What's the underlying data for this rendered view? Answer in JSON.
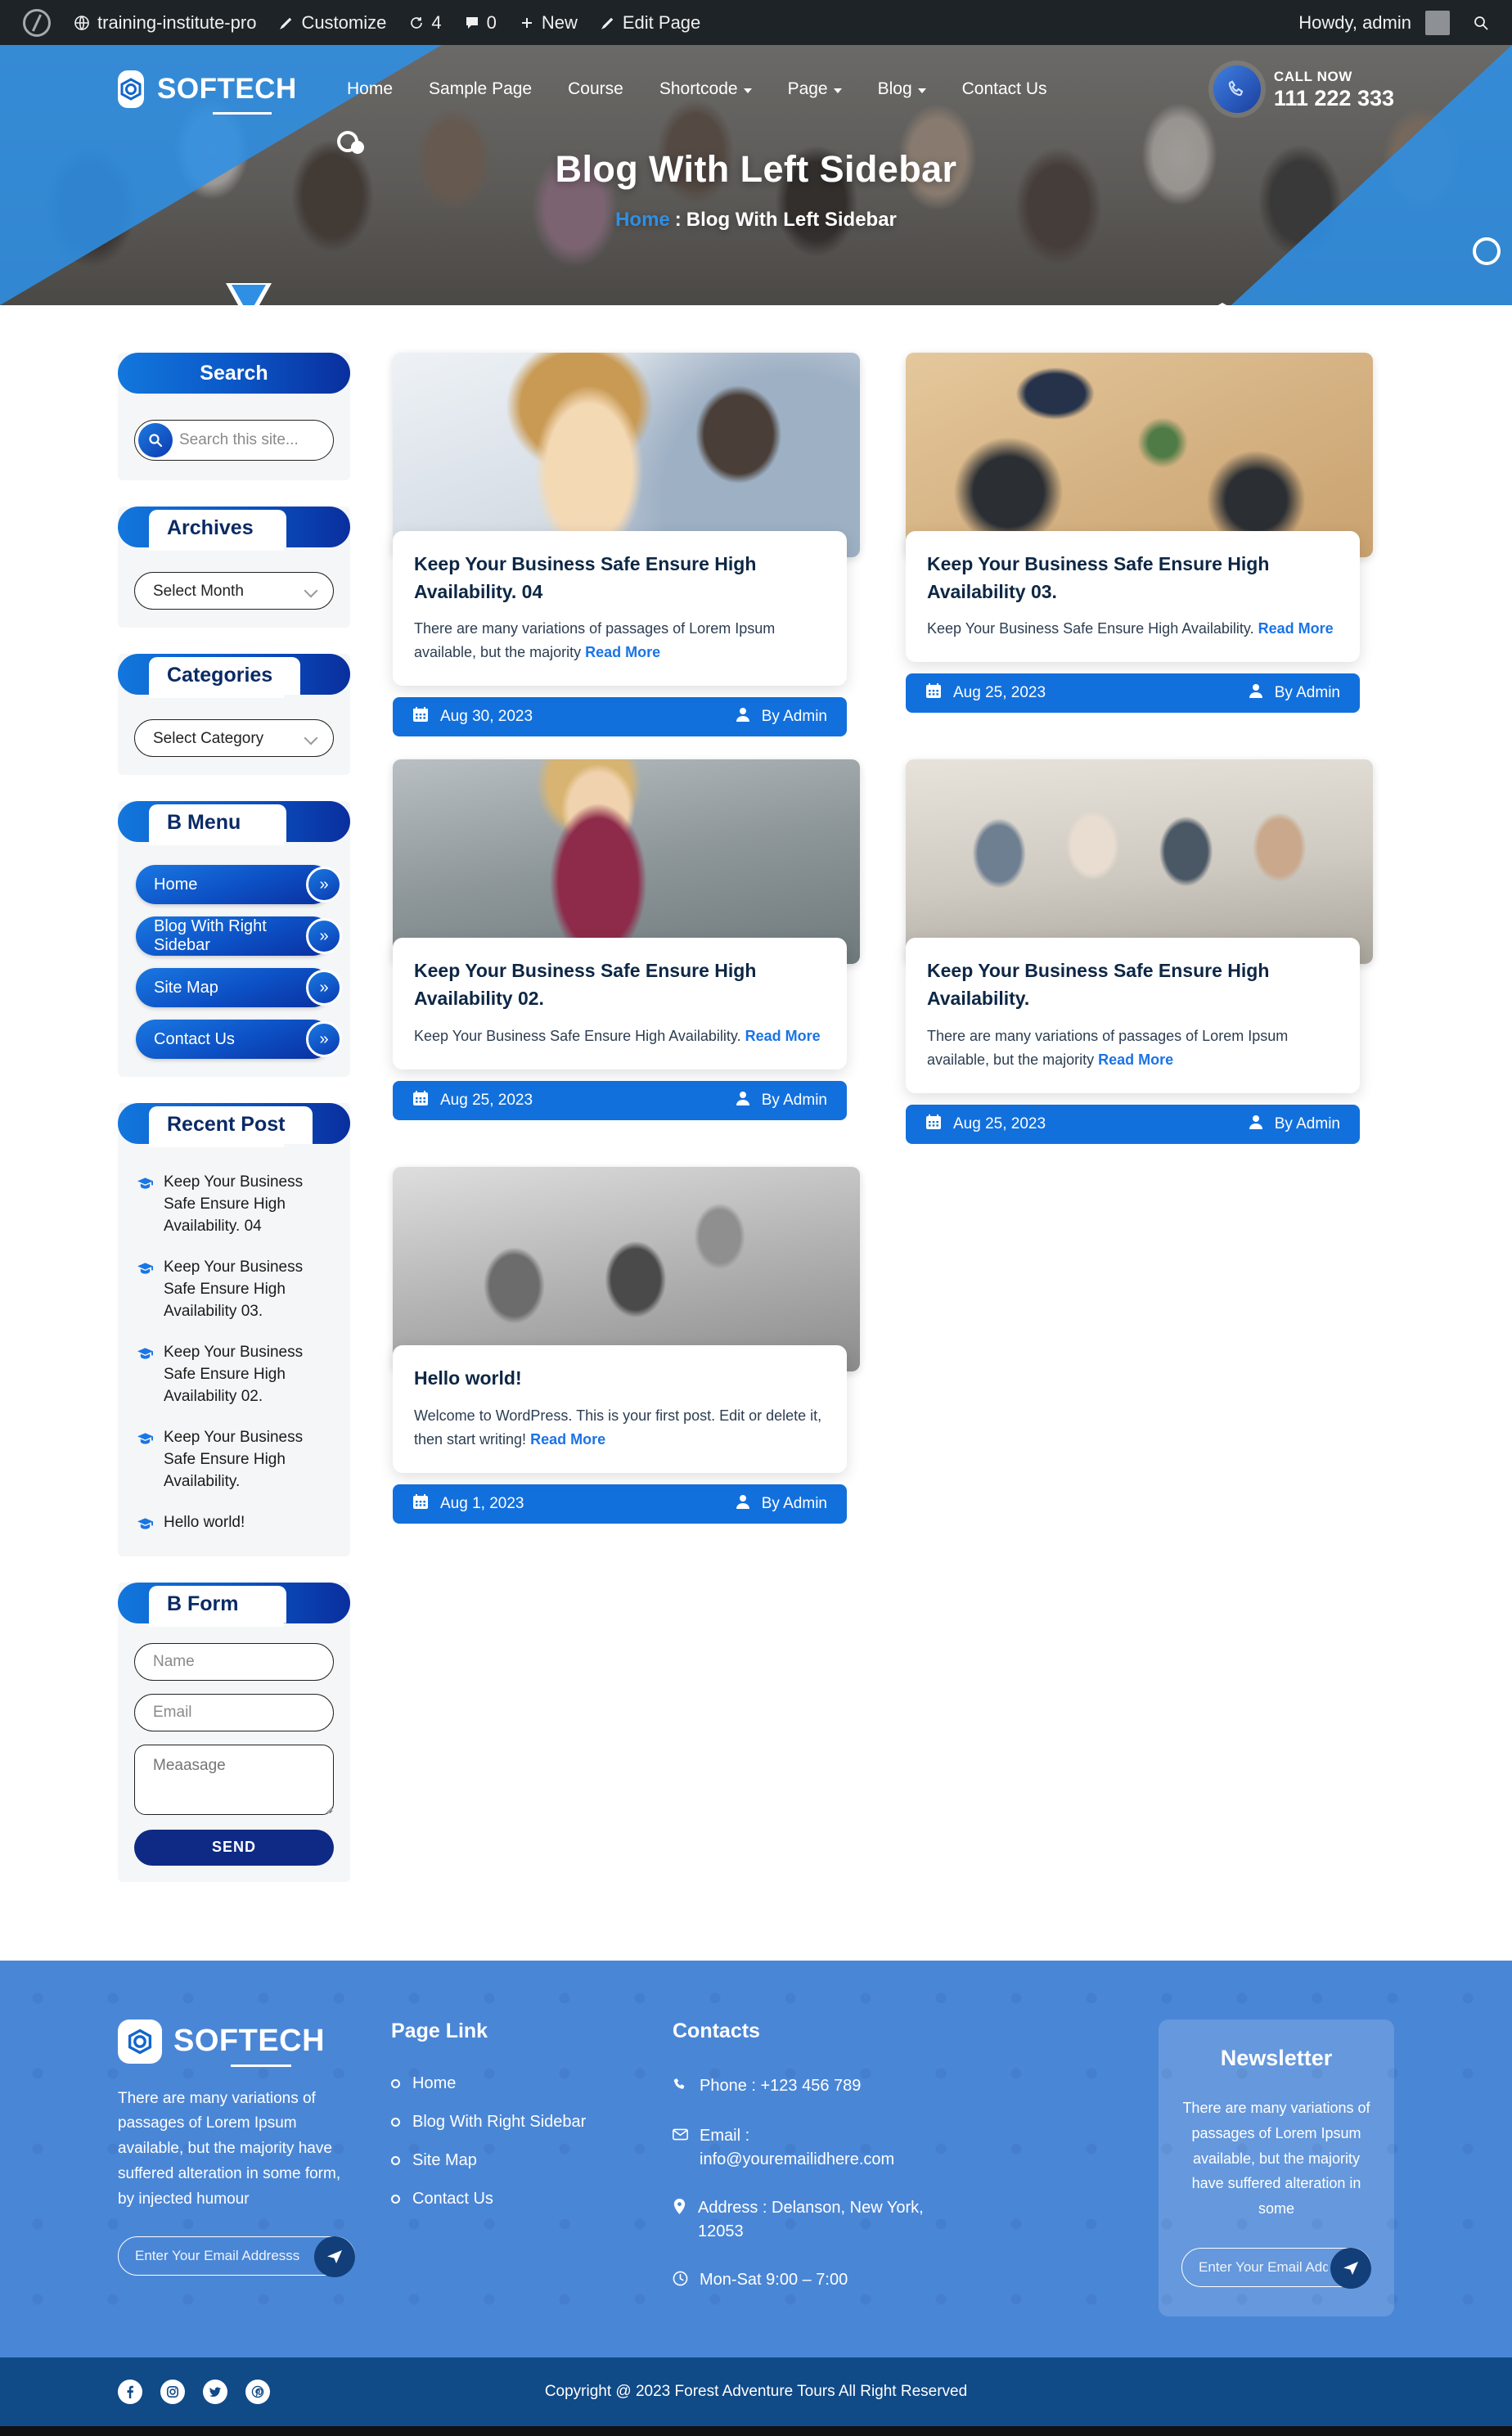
{
  "adminbar": {
    "site_name": "training-institute-pro",
    "customize": "Customize",
    "updates_count": "4",
    "comments_count": "0",
    "new": "New",
    "edit_page": "Edit Page",
    "howdy": "Howdy, admin"
  },
  "header": {
    "brand": "SOFTECH",
    "nav": [
      {
        "label": "Home",
        "has_caret": false
      },
      {
        "label": "Sample Page",
        "has_caret": false
      },
      {
        "label": "Course",
        "has_caret": false
      },
      {
        "label": "Shortcode",
        "has_caret": true
      },
      {
        "label": "Page",
        "has_caret": true
      },
      {
        "label": "Blog",
        "has_caret": true
      },
      {
        "label": "Contact Us",
        "has_caret": false
      }
    ],
    "call_label": "CALL NOW",
    "call_number": "111 222 333",
    "page_title": "Blog With Left Sidebar",
    "breadcrumb_home": "Home",
    "breadcrumb_sep": ":",
    "breadcrumb_current": "Blog With Left Sidebar"
  },
  "sidebar": {
    "search": {
      "title": "Search",
      "placeholder": "Search this site..."
    },
    "archives": {
      "title": "Archives",
      "selected": "Select Month"
    },
    "categories": {
      "title": "Categories",
      "selected": "Select Category"
    },
    "bmenu": {
      "title": "B Menu",
      "items": [
        {
          "label": "Home"
        },
        {
          "label": "Blog With Right Sidebar"
        },
        {
          "label": "Site Map"
        },
        {
          "label": "Contact Us"
        }
      ]
    },
    "recent": {
      "title": "Recent Post",
      "items": [
        {
          "label": "Keep Your Business Safe Ensure High Availability. 04"
        },
        {
          "label": "Keep Your Business Safe Ensure High Availability 03."
        },
        {
          "label": "Keep Your Business Safe Ensure High Availability 02."
        },
        {
          "label": "Keep Your Business Safe Ensure High Availability."
        },
        {
          "label": "Hello world!"
        }
      ]
    },
    "bform": {
      "title": "B Form",
      "name_placeholder": "Name",
      "email_placeholder": "Email",
      "message_placeholder": "Meaasage",
      "send_label": "SEND"
    }
  },
  "posts": [
    {
      "title": "Keep Your Business Safe Ensure High Availability. 04",
      "excerpt": "There are many variations of passages of Lorem Ipsum available, but the majority",
      "read_more": "Read More",
      "date": "Aug 30, 2023",
      "author": "By Admin"
    },
    {
      "title": "Keep Your Business Safe Ensure High Availability 03.",
      "excerpt": "Keep Your Business Safe Ensure High Availability.",
      "read_more": "Read More",
      "date": "Aug 25, 2023",
      "author": "By Admin"
    },
    {
      "title": "Keep Your Business Safe Ensure High Availability 02.",
      "excerpt": "Keep Your Business Safe Ensure High Availability.",
      "read_more": "Read More",
      "date": "Aug 25, 2023",
      "author": "By Admin"
    },
    {
      "title": "Keep Your Business Safe Ensure High Availability.",
      "excerpt": "There are many variations of passages of Lorem Ipsum available, but the majority",
      "read_more": "Read More",
      "date": "Aug 25, 2023",
      "author": "By Admin"
    },
    {
      "title": "Hello world!",
      "excerpt": "Welcome to WordPress. This is your first post. Edit or delete it, then start writing!",
      "read_more": "Read More",
      "date": "Aug 1, 2023",
      "author": "By Admin"
    }
  ],
  "footer": {
    "brand": "SOFTECH",
    "about": "There are many variations of passages of Lorem Ipsum available, but the majority have suffered alteration in some form, by injected humour",
    "subscribe_placeholder": "Enter Your Email Addresss",
    "pagelink_title": "Page Link",
    "pagelinks": [
      {
        "label": "Home"
      },
      {
        "label": "Blog With Right Sidebar"
      },
      {
        "label": "Site Map"
      },
      {
        "label": "Contact Us"
      }
    ],
    "contacts_title": "Contacts",
    "phone": "Phone : +123 456 789",
    "email": "Email : info@youremailidhere.com",
    "address": "Address : Delanson, New York, 12053",
    "hours": "Mon-Sat 9:00 – 7:00",
    "newsletter_title": "Newsletter",
    "newsletter_text": "There are many variations of passages of Lorem Ipsum available, but the majority have suffered alteration in some",
    "newsletter_placeholder": "Enter Your Email Addresss",
    "copyright": "Copyright @ 2023 Forest Adventure Tours All Right Reserved"
  },
  "colors": {
    "brand_blue": "#1270dd",
    "deep_blue": "#0a2f9e",
    "footer_blue": "#4a86d6",
    "copy_blue": "#104a87",
    "link_blue": "#1a73e8"
  }
}
